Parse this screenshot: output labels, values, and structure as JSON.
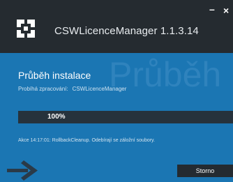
{
  "window": {
    "title": "CSWLicenceManager 1.1.3.14",
    "minimize_glyph": "–",
    "close_glyph": "×"
  },
  "watermark": "Průběh",
  "heading": "Průběh instalace",
  "processing": {
    "label": "Probíhá zpracování:",
    "value": "CSWLicenceManager"
  },
  "progress": {
    "percent": 100,
    "label": "100%"
  },
  "status_line": "Akce 14:17:01: RollbackCleanup. Odebírají se záložní soubory.",
  "cancel_label": "Storno",
  "icons": {
    "logo": "app-logo-icon",
    "arrow": "arrow-right-icon"
  },
  "colors": {
    "titlebar": "#252b30",
    "body": "#1b76b3",
    "progress_track": "#1c2a36",
    "button": "#242b31",
    "text": "#ffffff"
  }
}
